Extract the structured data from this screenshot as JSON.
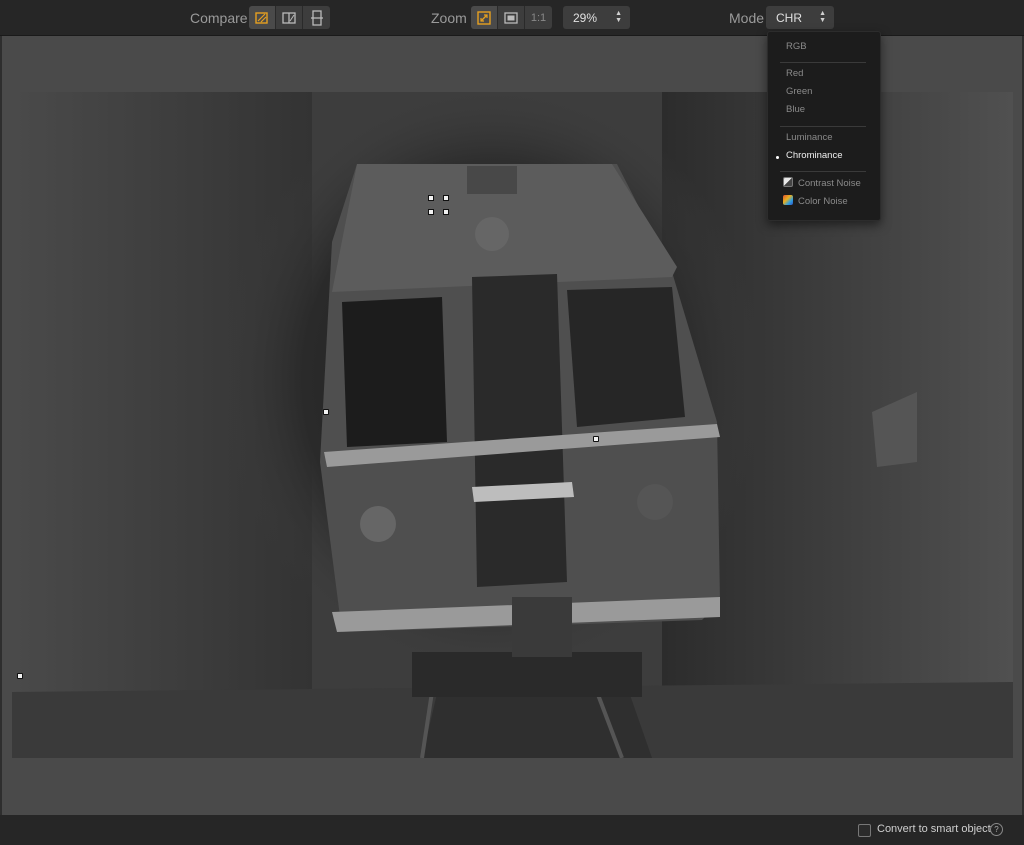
{
  "toolbar": {
    "compare_label": "Compare",
    "zoom_label": "Zoom",
    "zoom_one_to_one": "1:1",
    "zoom_value": "29%",
    "mode_label": "Mode",
    "mode_value": "CHR",
    "accent_color": "#e6a020"
  },
  "mode_menu": {
    "items": [
      "RGB",
      "Red",
      "Green",
      "Blue",
      "Luminance",
      "Chrominance",
      "Contrast Noise",
      "Color Noise"
    ],
    "selected": "Chrominance"
  },
  "footer": {
    "convert_label": "Convert to smart object",
    "help_glyph": "?"
  }
}
